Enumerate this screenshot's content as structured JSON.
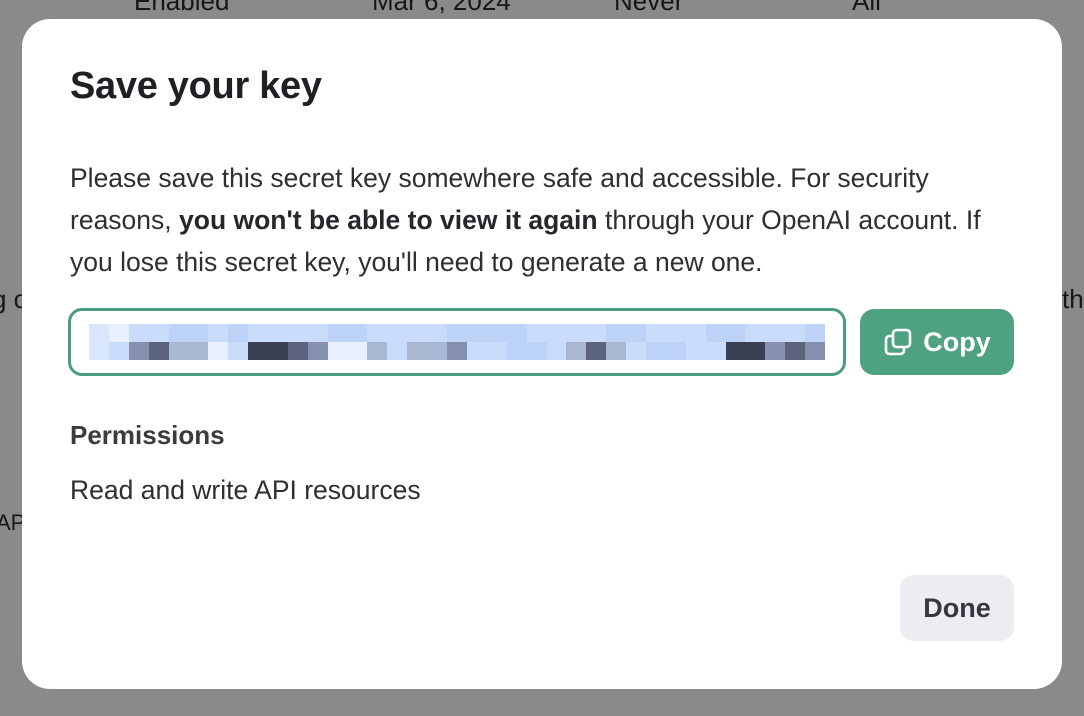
{
  "background": {
    "row_fragments": [
      "Enabled",
      "Mar 6, 2024",
      "Never",
      "All"
    ],
    "left_fragments": [
      "g c",
      "AP"
    ],
    "right_fragments": [
      "th"
    ]
  },
  "modal": {
    "title": "Save your key",
    "description": {
      "before_bold": "Please save this secret key somewhere safe and accessible. For security reasons, ",
      "bold": "you won't be able to view it again",
      "after_bold": " through your OpenAI account. If you lose this secret key, you'll need to generate a new one."
    },
    "secret_key": {
      "redacted": true
    },
    "copy_button": {
      "label": "Copy",
      "icon": "copy-icon"
    },
    "permissions": {
      "heading": "Permissions",
      "value": "Read and write API resources"
    },
    "done_button": {
      "label": "Done"
    }
  },
  "colors": {
    "accent_green": "#4ea280",
    "field_border": "#4d9b7f",
    "done_bg": "#ececf1",
    "overlay": "rgba(0,0,0,0.46)"
  }
}
